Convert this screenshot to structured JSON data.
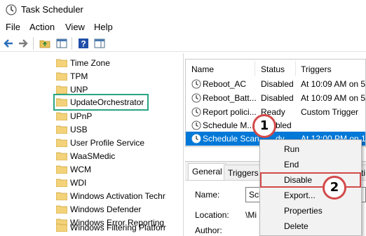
{
  "window": {
    "title": "Task Scheduler",
    "icon": "clock-icon"
  },
  "menubar": [
    "File",
    "Action",
    "View",
    "Help"
  ],
  "toolbar": [
    "back-arrow-icon",
    "forward-arrow-icon",
    "up-folder-icon",
    "show-hide-tree-icon",
    "help-icon",
    "properties-pane-icon"
  ],
  "tree": {
    "items": [
      {
        "label": "Time Zone"
      },
      {
        "label": "TPM"
      },
      {
        "label": "UNP"
      },
      {
        "label": "UpdateOrchestrator",
        "highlighted": true
      },
      {
        "label": "UPnP"
      },
      {
        "label": "USB"
      },
      {
        "label": "User Profile Service"
      },
      {
        "label": "WaaSMedic"
      },
      {
        "label": "WCM"
      },
      {
        "label": "WDI"
      },
      {
        "label": "Windows Activation Techr"
      },
      {
        "label": "Windows Defender"
      },
      {
        "label": "Windows Error Reporting"
      },
      {
        "label": "Windows Filtering Platforr"
      }
    ]
  },
  "tasks": {
    "columns": [
      "Name",
      "Status",
      "Triggers"
    ],
    "rows": [
      {
        "name": "Reboot_AC",
        "status": "Disabled",
        "trigger": "At 10:09 AM on 5/"
      },
      {
        "name": "Reboot_Batt...",
        "status": "Disabled",
        "trigger": "At 10:09 AM on 5/"
      },
      {
        "name": "Report polici...",
        "status": "Ready",
        "trigger": "Custom Trigger"
      },
      {
        "name": "Schedule M...",
        "status": "...bled",
        "trigger": ""
      },
      {
        "name": "Schedule Scan",
        "status": "...dy",
        "trigger": "At 12:00 PM on 1/",
        "selected": true
      }
    ],
    "selected_color": "#0078d7"
  },
  "details": {
    "tabs": [
      "General",
      "Triggers",
      "...ti"
    ],
    "fields": [
      {
        "label": "Name:",
        "value": "Sch"
      },
      {
        "label": "Location:",
        "value": "\\Mi"
      },
      {
        "label": "Author:",
        "value": ""
      }
    ]
  },
  "context_menu": {
    "items": [
      "Run",
      "End",
      "Disable",
      "Export...",
      "Properties",
      "Delete"
    ],
    "outlined_item": "Disable"
  },
  "callouts": [
    "1",
    "2"
  ],
  "colors": {
    "highlight_green": "#2aa584",
    "callout_red": "#d34a4a",
    "selection_blue": "#0078d7"
  }
}
